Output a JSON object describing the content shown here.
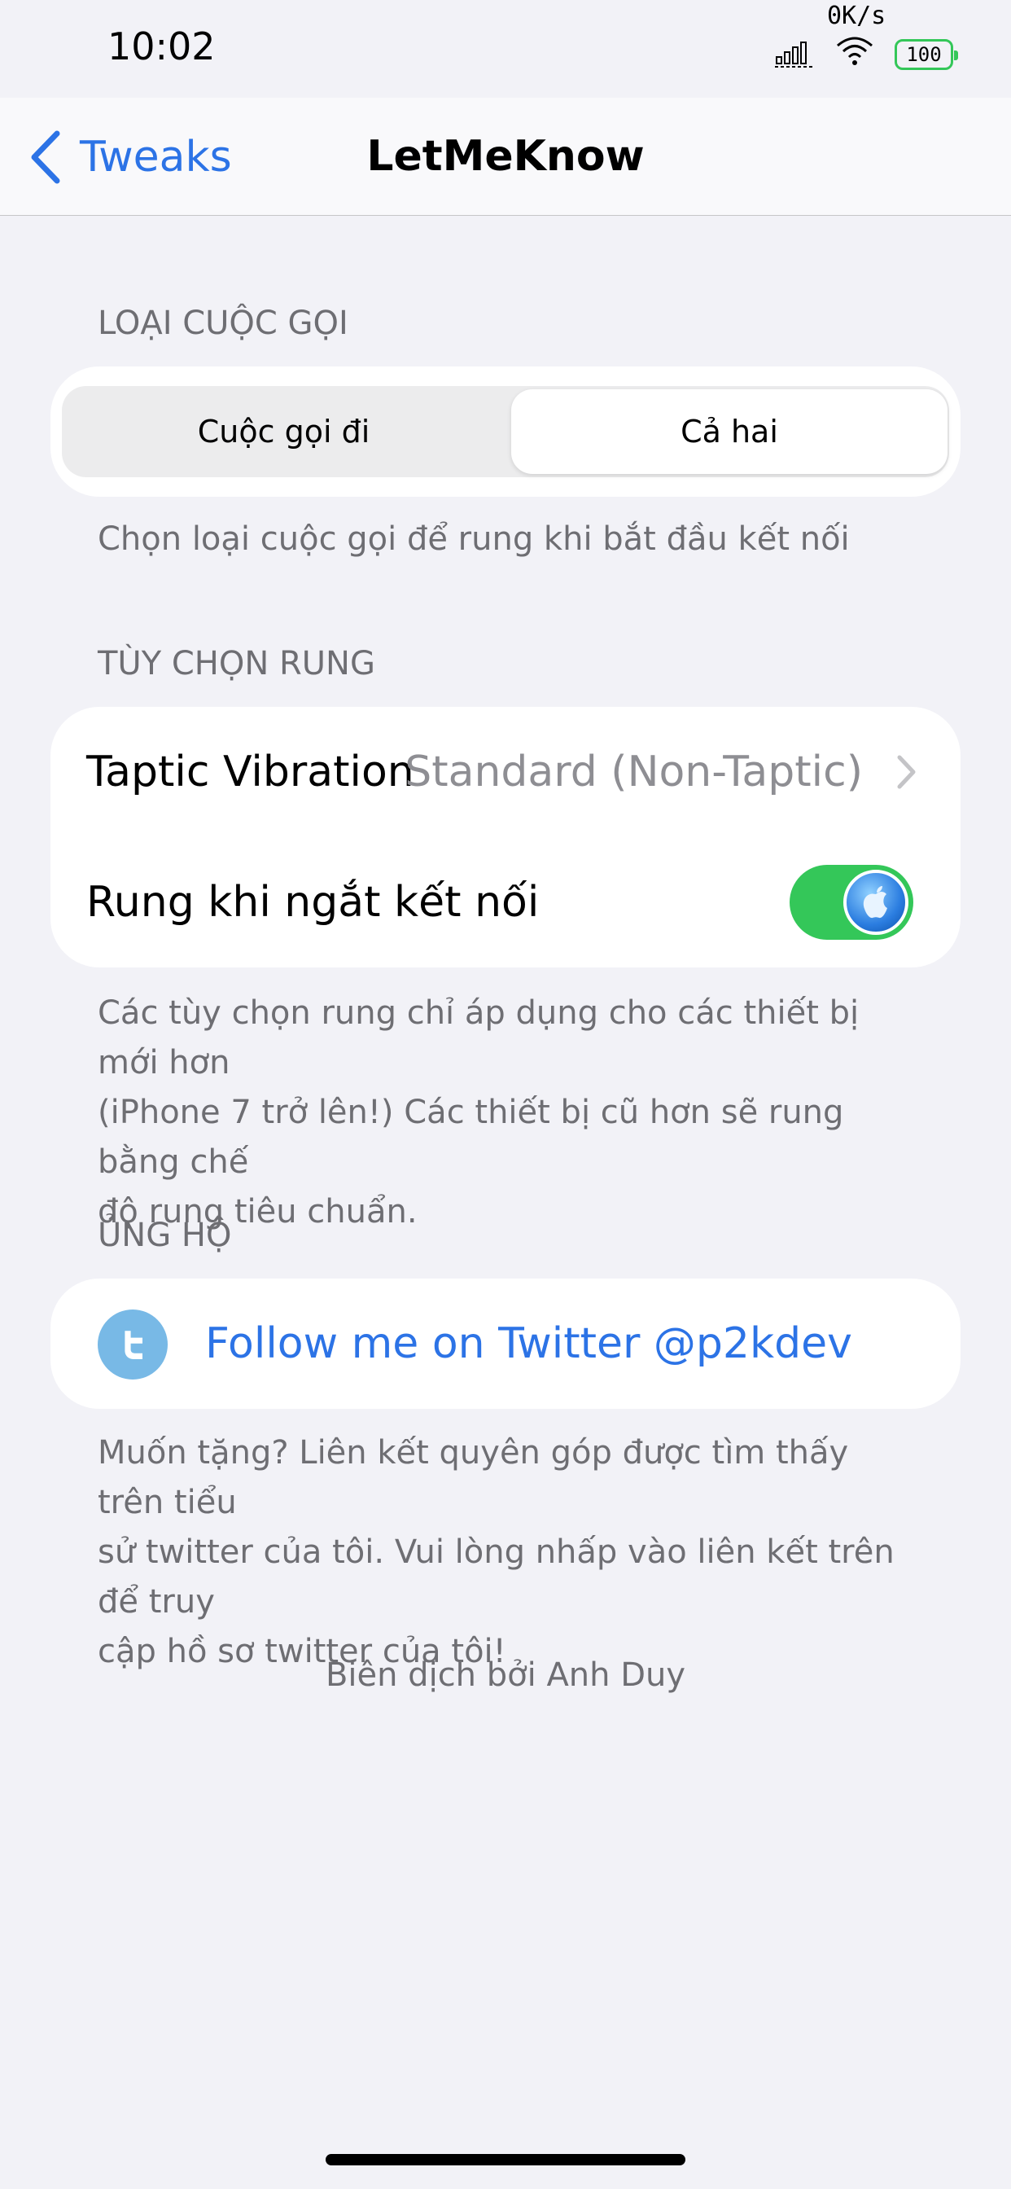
{
  "status_bar": {
    "time": "10:02",
    "net_speed": "0K/s",
    "battery": "100",
    "battery_color": "#34c759"
  },
  "nav": {
    "back_label": "Tweaks",
    "title": "LetMeKnow",
    "accent": "#2c73e6"
  },
  "call_type": {
    "header": "LOẠI CUỘC GỌI",
    "options": [
      "Cuộc gọi đi",
      "Cả hai"
    ],
    "selected": "Cả hai",
    "footer": "Chọn loại cuộc gọi để rung khi bắt đầu kết nối"
  },
  "vibration": {
    "header": "TÙY CHỌN RUNG",
    "taptic_label": "Taptic Vibration",
    "taptic_value": "Standard (Non-Taptic)",
    "disconnect_label": "Rung khi ngắt kết nối",
    "disconnect_on": true,
    "footer_lines": [
      "Các tùy chọn rung chỉ áp dụng cho các thiết bị mới hơn",
      "(iPhone 7 trở lên!) Các thiết bị cũ hơn sẽ rung bằng chế",
      "độ rung tiêu chuẩn."
    ]
  },
  "support": {
    "header": "ỦNG HỘ",
    "twitter_label": "Follow me on Twitter @p2kdev",
    "footer_lines": [
      "Muốn tặng? Liên kết quyên góp được tìm thấy trên tiểu",
      "sử twitter của tôi. Vui lòng nhấp vào liên kết trên để truy",
      "cập hồ sơ twitter của tôi!"
    ]
  },
  "credit": "Biên dịch bởi Anh Duy"
}
